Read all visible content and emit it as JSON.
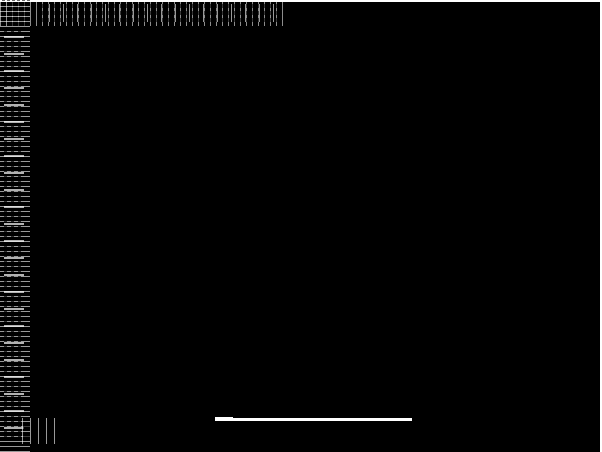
{
  "screen": {
    "background_color": "#000000",
    "edge_color": "#ffffff"
  },
  "progress": {
    "value": 1.0,
    "color": "#ffffff"
  }
}
